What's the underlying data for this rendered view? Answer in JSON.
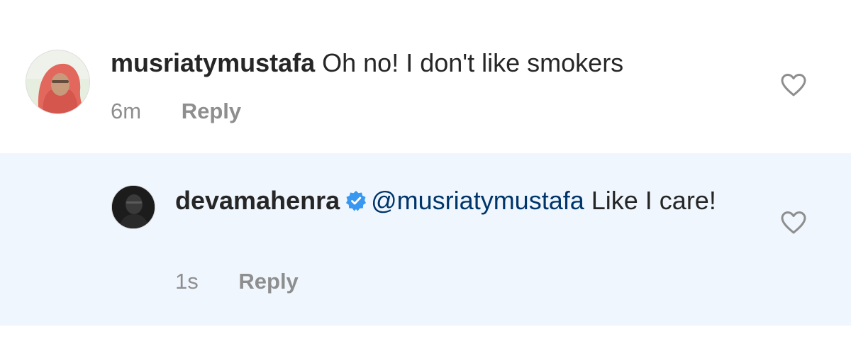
{
  "comments": [
    {
      "username": "musriatymustafa",
      "text": "Oh no! I don't like smokers",
      "time": "6m",
      "reply_label": "Reply",
      "avatar_icon": "avatar-hijab-photo",
      "like_icon": "heart-outline-icon"
    }
  ],
  "reply": {
    "username": "devamahenra",
    "verified_icon": "verified-badge-icon",
    "mention": "@musriatymustafa",
    "text": " Like I care!",
    "time": "1s",
    "reply_label": "Reply",
    "avatar_icon": "avatar-dark-photo",
    "like_icon": "heart-outline-icon"
  },
  "colors": {
    "reply_background": "#eff6fe",
    "mention": "#003569",
    "verified": "#3897f0",
    "meta_text": "#8e8e8e",
    "primary_text": "#262626"
  }
}
